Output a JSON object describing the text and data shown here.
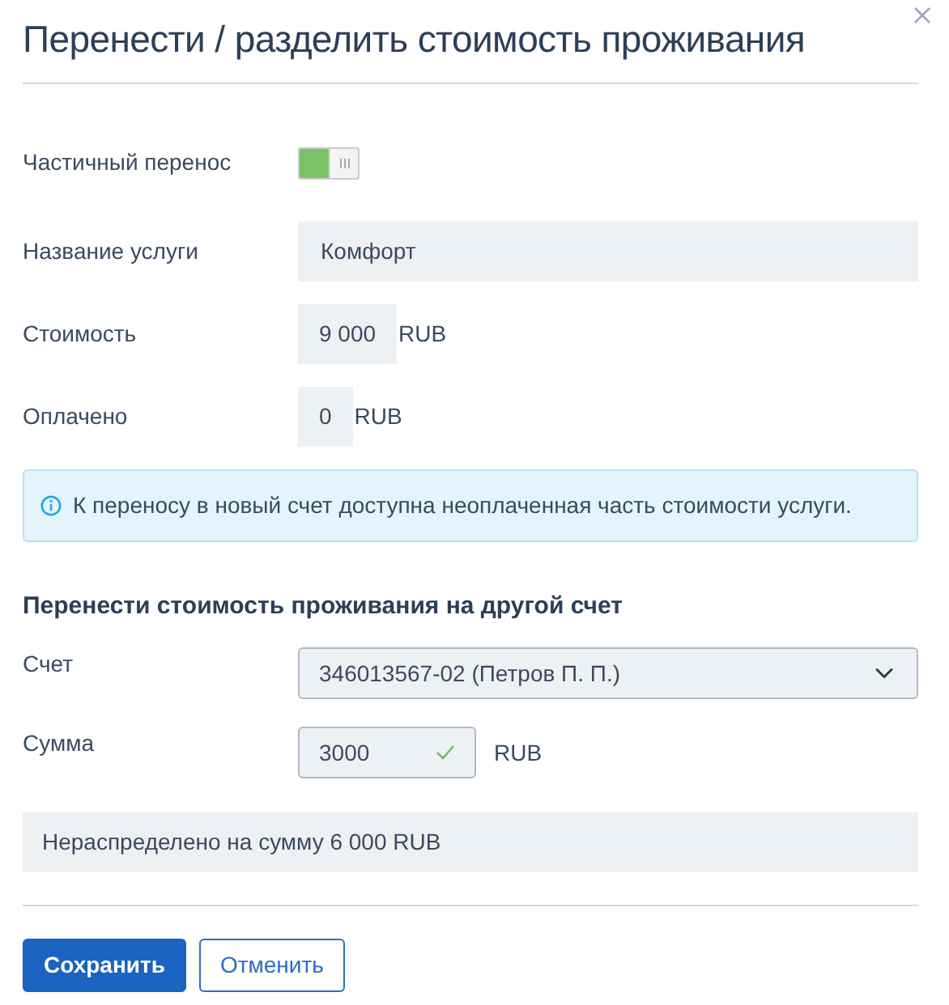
{
  "title": "Перенести / разделить стоимость проживания",
  "partial": {
    "label": "Частичный перенос",
    "on": true
  },
  "info_rows": [
    {
      "label": "Название услуги",
      "value": "Комфорт",
      "kind": "wide"
    },
    {
      "label": "Стоимость",
      "value": "9 000",
      "unit": "RUB",
      "kind": "amount"
    },
    {
      "label": "Оплачено",
      "value": "0",
      "unit": "RUB",
      "kind": "amount"
    }
  ],
  "alert": "К переносу в новый счет доступна неоплаченная часть стоимости услуги.",
  "section_title": "Перенести стоимость проживания на другой счет",
  "account": {
    "label": "Счет",
    "value": "346013567-02 (Петров П. П.)"
  },
  "sum": {
    "label": "Сумма",
    "value": "3000",
    "unit": "RUB",
    "valid": true
  },
  "unallocated": "Нераспределено на сумму 6 000 RUB",
  "buttons": [
    {
      "label": "Сохранить",
      "kind": "primary"
    },
    {
      "label": "Отменить",
      "kind": "outline"
    }
  ]
}
